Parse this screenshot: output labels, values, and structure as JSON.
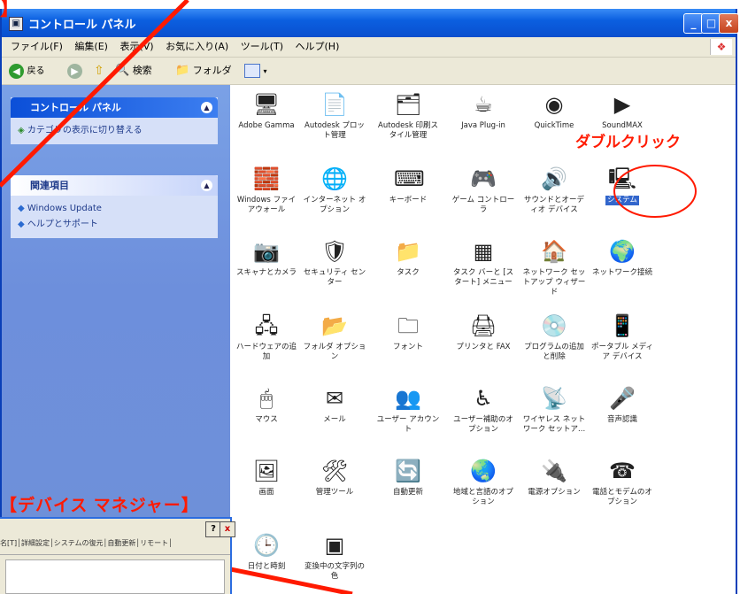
{
  "window": {
    "title": "コントロール パネル",
    "min": "_",
    "max": "□",
    "close": "x"
  },
  "menu": [
    "ファイル(F)",
    "編集(E)",
    "表示(V)",
    "お気に入り(A)",
    "ツール(T)",
    "ヘルプ(H)"
  ],
  "toolbar": {
    "back_label": "戻る",
    "search_label": "検索",
    "folders_label": "フォルダ"
  },
  "taskpane": {
    "box1_title": "コントロール パネル",
    "box1_link": "カテゴリの表示に切り替える",
    "box2_title": "関連項目",
    "box2_links": [
      "Windows Update",
      "ヘルプとサポート"
    ]
  },
  "icons": [
    {
      "label": "Adobe Gamma",
      "glyph": "🖥"
    },
    {
      "label": "Autodesk プロット管理",
      "glyph": "📄"
    },
    {
      "label": "Autodesk 印刷スタイル管理",
      "glyph": "🗂"
    },
    {
      "label": "Java Plug-in",
      "glyph": "☕"
    },
    {
      "label": "QuickTime",
      "glyph": "◉"
    },
    {
      "label": "SoundMAX",
      "glyph": "▶"
    },
    {
      "label": "Windows ファイアウォール",
      "glyph": "🧱"
    },
    {
      "label": "インターネット オプション",
      "glyph": "🌐"
    },
    {
      "label": "キーボード",
      "glyph": "⌨"
    },
    {
      "label": "ゲーム コントローラ",
      "glyph": "🎮"
    },
    {
      "label": "サウンドとオーディオ デバイス",
      "glyph": "🔊"
    },
    {
      "label": "システム",
      "glyph": "🖳"
    },
    {
      "label": "スキャナとカメラ",
      "glyph": "📷"
    },
    {
      "label": "セキュリティ センター",
      "glyph": "🛡"
    },
    {
      "label": "タスク",
      "glyph": "📁"
    },
    {
      "label": "タスク バーと [スタート] メニュー",
      "glyph": "▦"
    },
    {
      "label": "ネットワーク セットアップ ウィザード",
      "glyph": "🏠"
    },
    {
      "label": "ネットワーク接続",
      "glyph": "🌍"
    },
    {
      "label": "ハードウェアの追加",
      "glyph": "🖧"
    },
    {
      "label": "フォルダ オプション",
      "glyph": "📂"
    },
    {
      "label": "フォント",
      "glyph": "🗀"
    },
    {
      "label": "プリンタと FAX",
      "glyph": "🖨"
    },
    {
      "label": "プログラムの追加と削除",
      "glyph": "💿"
    },
    {
      "label": "ポータブル メディア デバイス",
      "glyph": "📱"
    },
    {
      "label": "マウス",
      "glyph": "🖱"
    },
    {
      "label": "メール",
      "glyph": "✉"
    },
    {
      "label": "ユーザー アカウント",
      "glyph": "👥"
    },
    {
      "label": "ユーザー補助のオプション",
      "glyph": "♿"
    },
    {
      "label": "ワイヤレス ネットワーク セットア...",
      "glyph": "📡"
    },
    {
      "label": "音声認識",
      "glyph": "🎤"
    },
    {
      "label": "画面",
      "glyph": "🖼"
    },
    {
      "label": "管理ツール",
      "glyph": "🛠"
    },
    {
      "label": "自動更新",
      "glyph": "🔄"
    },
    {
      "label": "地域と言語のオプション",
      "glyph": "🌏"
    },
    {
      "label": "電源オプション",
      "glyph": "🔌"
    },
    {
      "label": "電話とモデムのオプション",
      "glyph": "☎"
    },
    {
      "label": "日付と時刻",
      "glyph": "🕒"
    },
    {
      "label": "変換中の文字列の色",
      "glyph": "▣"
    }
  ],
  "annotations": {
    "double_click": "ダブルクリック",
    "device_manager": "【デバイス マネジャー】",
    "top_bracket": "】"
  },
  "subwindow": {
    "help": "?",
    "close": "x",
    "tabs_text": "名[T]│詳細設定│システムの復元│自動更新│リモート│"
  },
  "colors": {
    "annotation": "#ff1a00",
    "titlebar": "#0b5fe0",
    "selection": "#3266cc"
  }
}
